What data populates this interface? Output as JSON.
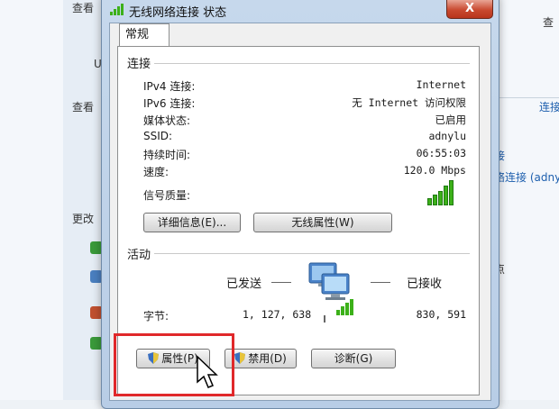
{
  "background": {
    "left_texts": [
      "查看",
      "U",
      "查看",
      "更改"
    ],
    "right_texts": [
      "查",
      "连接",
      "接",
      "络连接 (adny",
      "点"
    ]
  },
  "dialog": {
    "title": "无线网络连接 状态",
    "close_label": "X",
    "tab": "常规",
    "connection": {
      "title": "连接",
      "rows": [
        {
          "label": "IPv4 连接:",
          "value": "Internet"
        },
        {
          "label": "IPv6 连接:",
          "value": "无 Internet 访问权限"
        },
        {
          "label": "媒体状态:",
          "value": "已启用"
        },
        {
          "label": "SSID:",
          "value": "adnylu"
        },
        {
          "label": "持续时间:",
          "value": "06:55:03"
        },
        {
          "label": "速度:",
          "value": "120.0 Mbps"
        }
      ],
      "signal_label": "信号质量:",
      "signal_bars": 5,
      "details_button": "详细信息(E)...",
      "wireless_button": "无线属性(W)"
    },
    "activity": {
      "title": "活动",
      "sent_label": "已发送",
      "received_label": "已接收",
      "bytes_label": "字节:",
      "sent_bytes": "1, 127, 638",
      "received_bytes": "830, 591"
    },
    "buttons": {
      "properties": "属性(P)",
      "disable": "禁用(D)",
      "diagnose": "诊断(G)"
    }
  }
}
